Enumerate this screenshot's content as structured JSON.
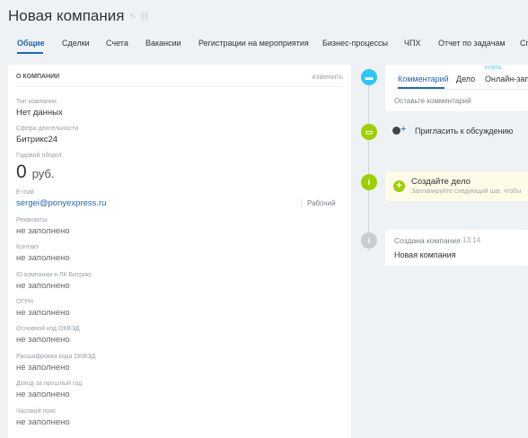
{
  "page": {
    "title": "Новая компания"
  },
  "tabs": [
    "Общие",
    "Сделки",
    "Счета",
    "Вакансии",
    "Регистрации на мероприятия",
    "Бизнес-процессы",
    "ЧПХ",
    "Отчет по задачам",
    "Сп"
  ],
  "card": {
    "title": "О компании",
    "edit": "изменить",
    "fields": {
      "type": {
        "label": "Тип компании",
        "value": "Нет данных"
      },
      "industry": {
        "label": "Сфера деятельности",
        "value": "Битрикс24"
      },
      "revenue": {
        "label": "Годовой оборот",
        "amount": "0",
        "currency": "руб."
      },
      "email": {
        "label": "E-mail",
        "value": "sergei@ponyexpress.ru",
        "type": "Рабочий"
      },
      "requisites": {
        "label": "Реквизиты",
        "value": "не заполнено"
      },
      "contact": {
        "label": "Контакт",
        "value": "не заполнено"
      },
      "lk_id": {
        "label": "ID компании в ЛК Битрикс",
        "value": "не заполнено"
      },
      "ogrn": {
        "label": "ОГРН",
        "value": "не заполнено"
      },
      "okved": {
        "label": "Основной код ОКВЭД",
        "value": "не заполнено"
      },
      "okved_decode": {
        "label": "Расшифровка кода ОКВЭД",
        "value": "не заполнено"
      },
      "income": {
        "label": "Доход за прошлый год",
        "value": "не заполнено"
      },
      "timezone": {
        "label": "Часовой пояс",
        "value": "не заполнено"
      }
    }
  },
  "timeline": {
    "editor_tabs": [
      "Комментарий",
      "Дело",
      "Онлайн-запи"
    ],
    "new_badge": "НОВОЕ",
    "comment_placeholder": "Оставьте комментарий",
    "invite": "Пригласить к обсуждению",
    "create_task": {
      "title": "Создайте дело",
      "subtitle": "Запланируйте следующий шаг, чтобы"
    },
    "created": {
      "title": "Создана компания",
      "time": "13:14",
      "text": "Новая компания"
    }
  },
  "colors": {
    "accent": "#2067b0",
    "comment": "#2fc6f6",
    "invite": "#9dcf00",
    "info": "#9dcf00",
    "history": "#c9cdd1"
  }
}
